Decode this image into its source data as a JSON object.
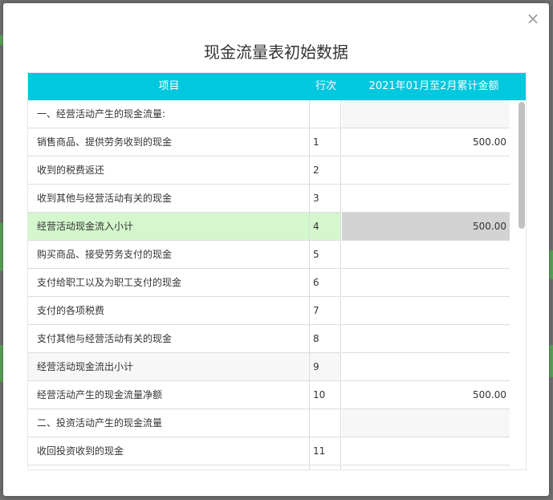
{
  "dialog": {
    "title": "现金流量表初始数据",
    "close_glyph": "×"
  },
  "table": {
    "headers": [
      "项目",
      "行次",
      "2021年01月至2月累计金额"
    ],
    "rows": [
      {
        "item": "一、经营活动产生的现金流量:",
        "line": "",
        "amount": "",
        "kind": "section"
      },
      {
        "item": "销售商品、提供劳务收到的现金",
        "line": "1",
        "amount": "500.00",
        "kind": "normal"
      },
      {
        "item": "收到的税费返还",
        "line": "2",
        "amount": "",
        "kind": "normal"
      },
      {
        "item": "收到其他与经营活动有关的现金",
        "line": "3",
        "amount": "",
        "kind": "normal"
      },
      {
        "item": "经营活动现金流入小计",
        "line": "4",
        "amount": "500.00",
        "kind": "highlight"
      },
      {
        "item": "购买商品、接受劳务支付的现金",
        "line": "5",
        "amount": "",
        "kind": "normal"
      },
      {
        "item": "支付给职工以及为职工支付的现金",
        "line": "6",
        "amount": "",
        "kind": "normal"
      },
      {
        "item": "支付的各项税费",
        "line": "7",
        "amount": "",
        "kind": "normal"
      },
      {
        "item": "支付其他与经营活动有关的现金",
        "line": "8",
        "amount": "",
        "kind": "normal"
      },
      {
        "item": "经营活动现金流出小计",
        "line": "9",
        "amount": "",
        "kind": "gray-item"
      },
      {
        "item": "经营活动产生的现金流量净额",
        "line": "10",
        "amount": "500.00",
        "kind": "normal"
      },
      {
        "item": "二、投资活动产生的现金流量",
        "line": "",
        "amount": "",
        "kind": "section"
      },
      {
        "item": "收回投资收到的现金",
        "line": "11",
        "amount": "",
        "kind": "normal"
      },
      {
        "item": "",
        "line": "",
        "amount": "",
        "kind": "normal"
      }
    ]
  },
  "colors": {
    "header_bg": "#00c8df",
    "highlight_bg": "#d4f7cd",
    "amount_highlight_bg": "#d3d3d3"
  }
}
